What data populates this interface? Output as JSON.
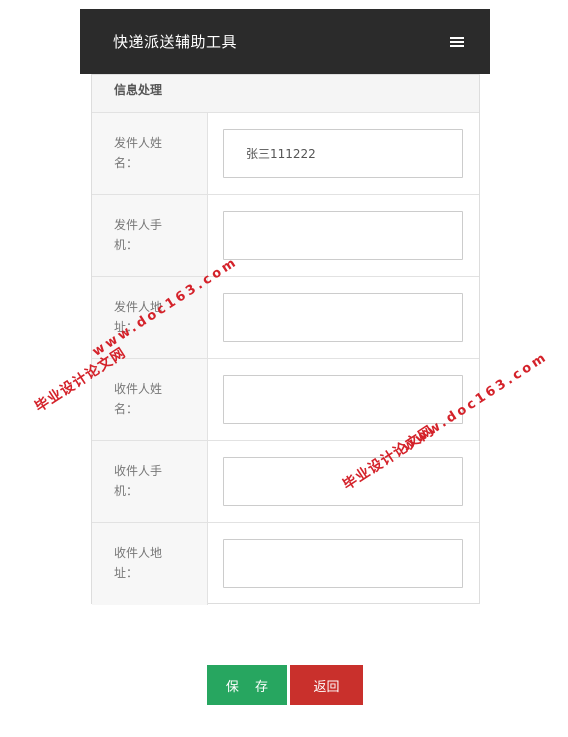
{
  "header": {
    "title": "快递派送辅助工具",
    "menu_icon": "hamburger-icon"
  },
  "panel": {
    "heading": "信息处理"
  },
  "form": {
    "fields": [
      {
        "label": "发件人姓名：",
        "value": "张三111222"
      },
      {
        "label": "发件人手机：",
        "value": ""
      },
      {
        "label": "发件人地址：",
        "value": ""
      },
      {
        "label": "收件人姓名：",
        "value": ""
      },
      {
        "label": "收件人手机：",
        "value": ""
      },
      {
        "label": "收件人地址：",
        "value": ""
      }
    ]
  },
  "actions": {
    "save_label": "保 存",
    "back_label": "返回"
  },
  "colors": {
    "navbar": "#2b2b2b",
    "save": "#27a660",
    "back": "#c9302c",
    "watermark": "#d4222a"
  },
  "watermarks": [
    {
      "text": "毕业设计论文网",
      "url": "www.doc163.com"
    },
    {
      "text": "毕业设计论文网",
      "url": "www.doc163.com"
    }
  ]
}
